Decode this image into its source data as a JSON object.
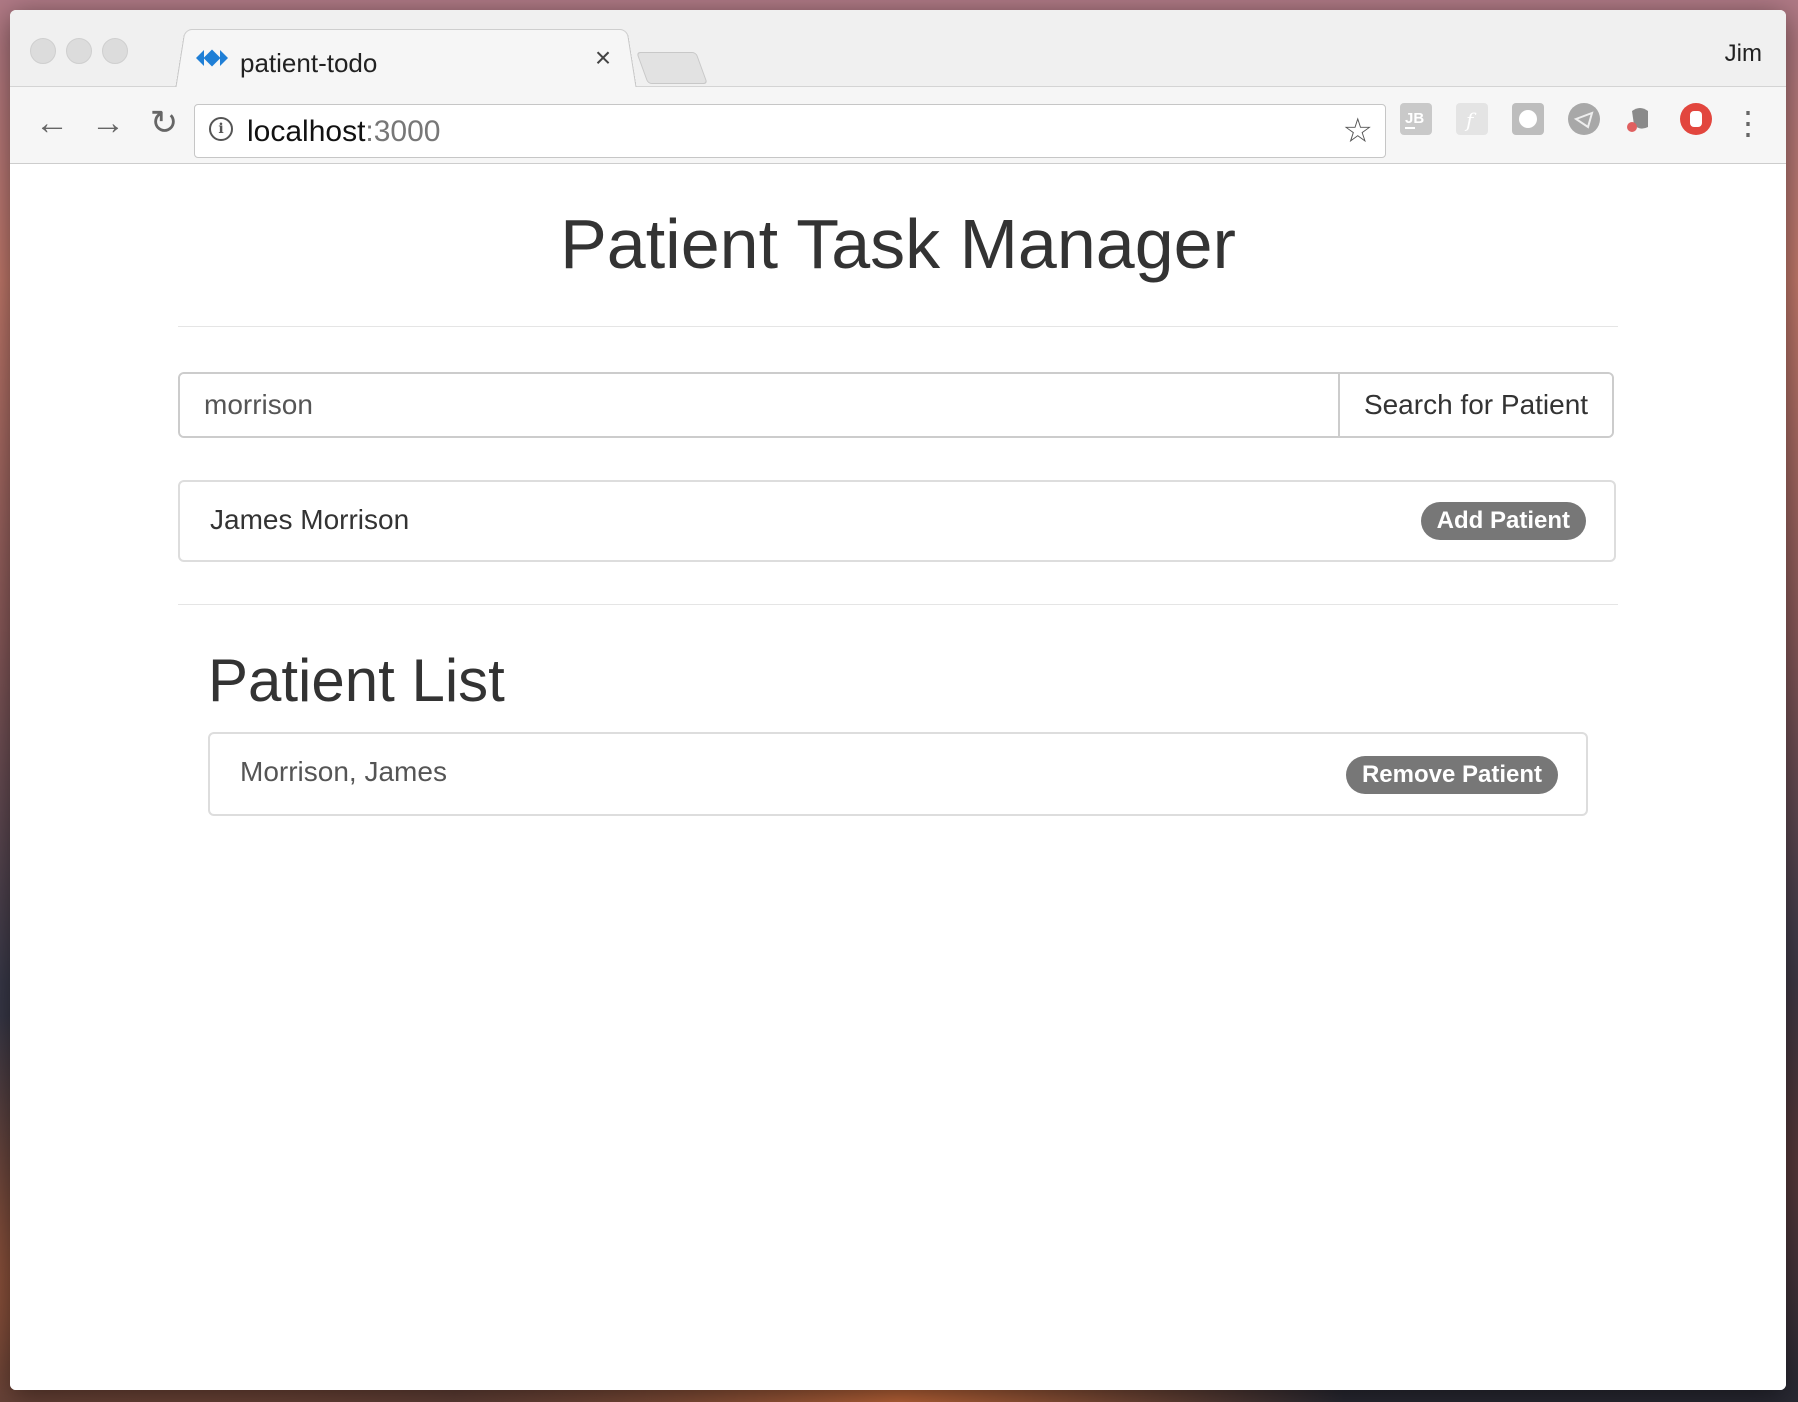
{
  "browser": {
    "tab_title": "patient-todo",
    "tab_close": "×",
    "profile_name": "Jim",
    "url_host": "localhost",
    "url_port": ":3000",
    "icons": [
      "back-icon",
      "forward-icon",
      "reload-icon",
      "info-icon",
      "star-icon",
      "jetbrains-icon",
      "flash-icon",
      "extension-icon",
      "extension-icon-2",
      "evernote-icon",
      "adblock-icon",
      "menu-icon"
    ]
  },
  "page": {
    "title": "Patient Task Manager",
    "search": {
      "value": "morrison",
      "button_label": "Search for Patient"
    },
    "search_results": [
      {
        "name": "James Morrison",
        "action_label": "Add Patient"
      }
    ],
    "list_heading": "Patient List",
    "patients": [
      {
        "name": "Morrison, James",
        "action_label": "Remove Patient"
      }
    ]
  },
  "colors": {
    "badge": "#777777",
    "text": "#333333",
    "border": "#dddddd"
  }
}
